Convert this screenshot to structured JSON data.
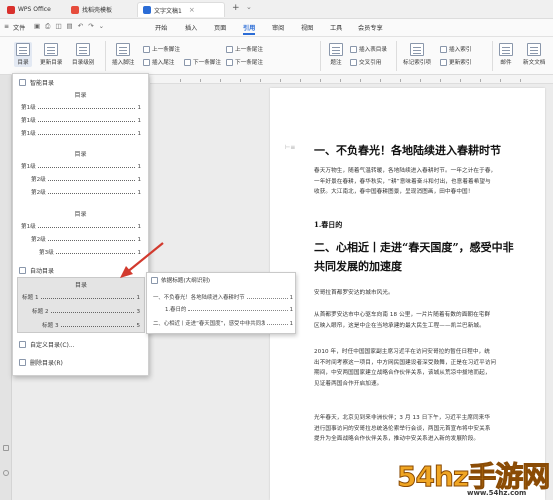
{
  "titlebar": {
    "tabs": [
      {
        "label": "WPS Office",
        "color": "#d9302c"
      },
      {
        "label": "找稻壳模板",
        "color": "#e64c3c"
      },
      {
        "label": "文字文稿1",
        "color": "#2b6cd6"
      }
    ],
    "new_tab": "+"
  },
  "quickbar": {
    "file_label": "文件"
  },
  "menus": [
    "开始",
    "插入",
    "页面",
    "引用",
    "审阅",
    "视图",
    "工具",
    "会员专享"
  ],
  "active_menu": "引用",
  "toolbar": {
    "toc": "目录",
    "update_toc": "更新目录",
    "toc_level": "目录级别",
    "insert_footnote": "插入脚注",
    "prev_footnote": "上一条脚注",
    "insert_endnote": "插入尾注",
    "next_footnote": "下一条脚注",
    "prev_endnote": "上一条尾注",
    "next_endnote": "下一条尾注",
    "caption": "题注",
    "insert_table_toc": "插入表目录",
    "cross_ref": "交叉引用",
    "mark_index": "标记索引项",
    "insert_index": "插入索引",
    "update_index": "更新索引",
    "mail": "邮件",
    "new_doc": "新文文档"
  },
  "toc_dropdown": {
    "smart_toc": "智能目录",
    "sections": [
      {
        "title": "目录",
        "rows": [
          {
            "label": "第1级",
            "page": "1"
          },
          {
            "label": "第1级",
            "page": "1"
          },
          {
            "label": "第1级",
            "page": "1"
          }
        ]
      },
      {
        "title": "目录",
        "rows": [
          {
            "label": "第1级",
            "page": "1"
          },
          {
            "label": "第2级",
            "page": "1"
          },
          {
            "label": "第2级",
            "page": "1"
          }
        ]
      },
      {
        "title": "目录",
        "rows": [
          {
            "label": "第1级",
            "page": "1"
          },
          {
            "label": "第2级",
            "page": "1"
          },
          {
            "label": "第3级",
            "page": "1"
          }
        ]
      }
    ],
    "auto_toc": "自动目录",
    "auto_section": {
      "title": "目录",
      "rows": [
        {
          "label": "标题 1",
          "page": "1"
        },
        {
          "label": "标题 2",
          "page": "3"
        },
        {
          "label": "标题 3",
          "page": "5"
        }
      ]
    },
    "custom_toc": "自定义目录(C)...",
    "delete_toc": "删除目录(R)"
  },
  "popup": {
    "title": "依据标题(大纲识别)",
    "rows": [
      {
        "label": "一、不负春光！各地陆续进入春耕时节",
        "page": "1"
      },
      {
        "label": "1.春日的",
        "page": "1"
      },
      {
        "label": "二、心相近丨走进“春天国度”，感受中非共同发展的加速度",
        "page": "1"
      }
    ]
  },
  "document": {
    "heading1": "一、不负春光！各地陆续进入春耕时节",
    "para1": [
      "春天万物生，随着气温转暖，各地陆续进入春耕时节。一年之计在于春，",
      "一年好景在春耕，春华秋实，“耕”意味着奋斗和付出，也意着着希望与",
      "收获。大江南北，春中国春耕图景，呈现消图画，田中春中国！"
    ],
    "heading1_1": "1.春日的",
    "heading2_lines": [
      "二、心相近丨走进“春天国度”，感受中非",
      "共同发展的加速度"
    ],
    "para2": [
      "安哥拉首都罗安达的城市风光。"
    ],
    "para3": [
      "从首都罗安达市中心驱车向南 18 公里，一片片随着有数的面朝在宅群",
      "区映入眼帘，这是中企在当地承建的最大民生工程——凯兰巴新城。"
    ],
    "para4": [
      "2010 年，时任中国国家副主席习近平在访问安哥拉的暂任日程中，统",
      "出不时间考察这一项目，中方网民国建设者深受鼓舞，正是在习近平访问",
      "期间，中安两国国家建立战略合作伙伴关系，该城从荒凉中拔地而起，",
      "见证着两国合作开启加速。"
    ],
    "para5": [
      "光年春天，北京见到来非洲伙伴；3 月 13 日下午，习近平主席同来华",
      "进行国事访问的安哥拉总统洛伦索举行会谈，两国元首宣布将中安关系",
      "提升为全面战略合作伙伴关系，推动中安关系进入新的发展阶段。"
    ]
  },
  "watermark": {
    "text": "54hz手游网",
    "site": "www.54hz.com"
  }
}
